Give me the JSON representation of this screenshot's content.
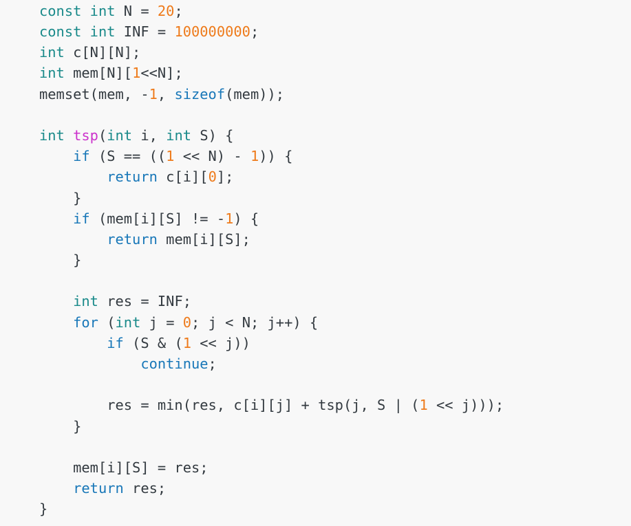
{
  "editor": {
    "language": "C++",
    "background_color": "#f8f8f8",
    "theme_colors": {
      "keyword": "#1877b8",
      "type_keyword": "#1a8a8a",
      "function_name": "#cc33cc",
      "number": "#ee7a1a",
      "plain_text": "#333a40"
    }
  },
  "code": {
    "plain_text": "const int N = 20;\nconst int INF = 100000000;\nint c[N][N];\nint mem[N][1<<N];\nmemset(mem, -1, sizeof(mem));\n\nint tsp(int i, int S) {\n    if (S == ((1 << N) - 1)) {\n        return c[i][0];\n    }\n    if (mem[i][S] != -1) {\n        return mem[i][S];\n    }\n\n    int res = INF;\n    for (int j = 0; j < N; j++) {\n        if (S & (1 << j))\n            continue;\n\n        res = min(res, c[i][j] + tsp(j, S | (1 << j)));\n    }\n\n    mem[i][S] = res;\n    return res;\n}",
    "lines": [
      {
        "n": 1,
        "tokens": [
          {
            "t": "const",
            "k": "type"
          },
          {
            "t": " ",
            "k": "plain"
          },
          {
            "t": "int",
            "k": "type"
          },
          {
            "t": " N = ",
            "k": "plain"
          },
          {
            "t": "20",
            "k": "num"
          },
          {
            "t": ";",
            "k": "punct"
          }
        ]
      },
      {
        "n": 2,
        "tokens": [
          {
            "t": "const",
            "k": "type"
          },
          {
            "t": " ",
            "k": "plain"
          },
          {
            "t": "int",
            "k": "type"
          },
          {
            "t": " INF = ",
            "k": "plain"
          },
          {
            "t": "100000000",
            "k": "num"
          },
          {
            "t": ";",
            "k": "punct"
          }
        ]
      },
      {
        "n": 3,
        "tokens": [
          {
            "t": "int",
            "k": "type"
          },
          {
            "t": " c[N][N];",
            "k": "plain"
          }
        ]
      },
      {
        "n": 4,
        "tokens": [
          {
            "t": "int",
            "k": "type"
          },
          {
            "t": " mem[N][",
            "k": "plain"
          },
          {
            "t": "1",
            "k": "num"
          },
          {
            "t": "<<N];",
            "k": "plain"
          }
        ]
      },
      {
        "n": 5,
        "tokens": [
          {
            "t": "memset(mem, -",
            "k": "plain"
          },
          {
            "t": "1",
            "k": "num"
          },
          {
            "t": ", ",
            "k": "plain"
          },
          {
            "t": "sizeof",
            "k": "kw"
          },
          {
            "t": "(mem));",
            "k": "plain"
          }
        ]
      },
      {
        "n": 6,
        "tokens": []
      },
      {
        "n": 7,
        "tokens": [
          {
            "t": "int",
            "k": "type"
          },
          {
            "t": " ",
            "k": "plain"
          },
          {
            "t": "tsp",
            "k": "func"
          },
          {
            "t": "(",
            "k": "plain"
          },
          {
            "t": "int",
            "k": "type"
          },
          {
            "t": " i, ",
            "k": "plain"
          },
          {
            "t": "int",
            "k": "type"
          },
          {
            "t": " S) {",
            "k": "plain"
          }
        ]
      },
      {
        "n": 8,
        "tokens": [
          {
            "t": "    ",
            "k": "plain"
          },
          {
            "t": "if",
            "k": "kw"
          },
          {
            "t": " (S == ((",
            "k": "plain"
          },
          {
            "t": "1",
            "k": "num"
          },
          {
            "t": " << N) - ",
            "k": "plain"
          },
          {
            "t": "1",
            "k": "num"
          },
          {
            "t": ")) {",
            "k": "plain"
          }
        ]
      },
      {
        "n": 9,
        "tokens": [
          {
            "t": "        ",
            "k": "plain"
          },
          {
            "t": "return",
            "k": "kw"
          },
          {
            "t": " c[i][",
            "k": "plain"
          },
          {
            "t": "0",
            "k": "num"
          },
          {
            "t": "];",
            "k": "plain"
          }
        ]
      },
      {
        "n": 10,
        "tokens": [
          {
            "t": "    }",
            "k": "plain"
          }
        ]
      },
      {
        "n": 11,
        "tokens": [
          {
            "t": "    ",
            "k": "plain"
          },
          {
            "t": "if",
            "k": "kw"
          },
          {
            "t": " (mem[i][S] != -",
            "k": "plain"
          },
          {
            "t": "1",
            "k": "num"
          },
          {
            "t": ") {",
            "k": "plain"
          }
        ]
      },
      {
        "n": 12,
        "tokens": [
          {
            "t": "        ",
            "k": "plain"
          },
          {
            "t": "return",
            "k": "kw"
          },
          {
            "t": " mem[i][S];",
            "k": "plain"
          }
        ]
      },
      {
        "n": 13,
        "tokens": [
          {
            "t": "    }",
            "k": "plain"
          }
        ]
      },
      {
        "n": 14,
        "tokens": []
      },
      {
        "n": 15,
        "tokens": [
          {
            "t": "    ",
            "k": "plain"
          },
          {
            "t": "int",
            "k": "type"
          },
          {
            "t": " res = INF;",
            "k": "plain"
          }
        ]
      },
      {
        "n": 16,
        "tokens": [
          {
            "t": "    ",
            "k": "plain"
          },
          {
            "t": "for",
            "k": "kw"
          },
          {
            "t": " (",
            "k": "plain"
          },
          {
            "t": "int",
            "k": "type"
          },
          {
            "t": " j = ",
            "k": "plain"
          },
          {
            "t": "0",
            "k": "num"
          },
          {
            "t": "; j < N; j++) {",
            "k": "plain"
          }
        ]
      },
      {
        "n": 17,
        "tokens": [
          {
            "t": "        ",
            "k": "plain"
          },
          {
            "t": "if",
            "k": "kw"
          },
          {
            "t": " (S & (",
            "k": "plain"
          },
          {
            "t": "1",
            "k": "num"
          },
          {
            "t": " << j))",
            "k": "plain"
          }
        ]
      },
      {
        "n": 18,
        "tokens": [
          {
            "t": "            ",
            "k": "plain"
          },
          {
            "t": "continue",
            "k": "kw"
          },
          {
            "t": ";",
            "k": "plain"
          }
        ]
      },
      {
        "n": 19,
        "tokens": []
      },
      {
        "n": 20,
        "tokens": [
          {
            "t": "        res = min(res, c[i][j] + tsp(j, S | (",
            "k": "plain"
          },
          {
            "t": "1",
            "k": "num"
          },
          {
            "t": " << j)));",
            "k": "plain"
          }
        ]
      },
      {
        "n": 21,
        "tokens": [
          {
            "t": "    }",
            "k": "plain"
          }
        ]
      },
      {
        "n": 22,
        "tokens": []
      },
      {
        "n": 23,
        "tokens": [
          {
            "t": "    mem[i][S] = res;",
            "k": "plain"
          }
        ]
      },
      {
        "n": 24,
        "tokens": [
          {
            "t": "    ",
            "k": "plain"
          },
          {
            "t": "return",
            "k": "kw"
          },
          {
            "t": " res;",
            "k": "plain"
          }
        ]
      },
      {
        "n": 25,
        "tokens": [
          {
            "t": "}",
            "k": "plain"
          }
        ]
      }
    ]
  }
}
